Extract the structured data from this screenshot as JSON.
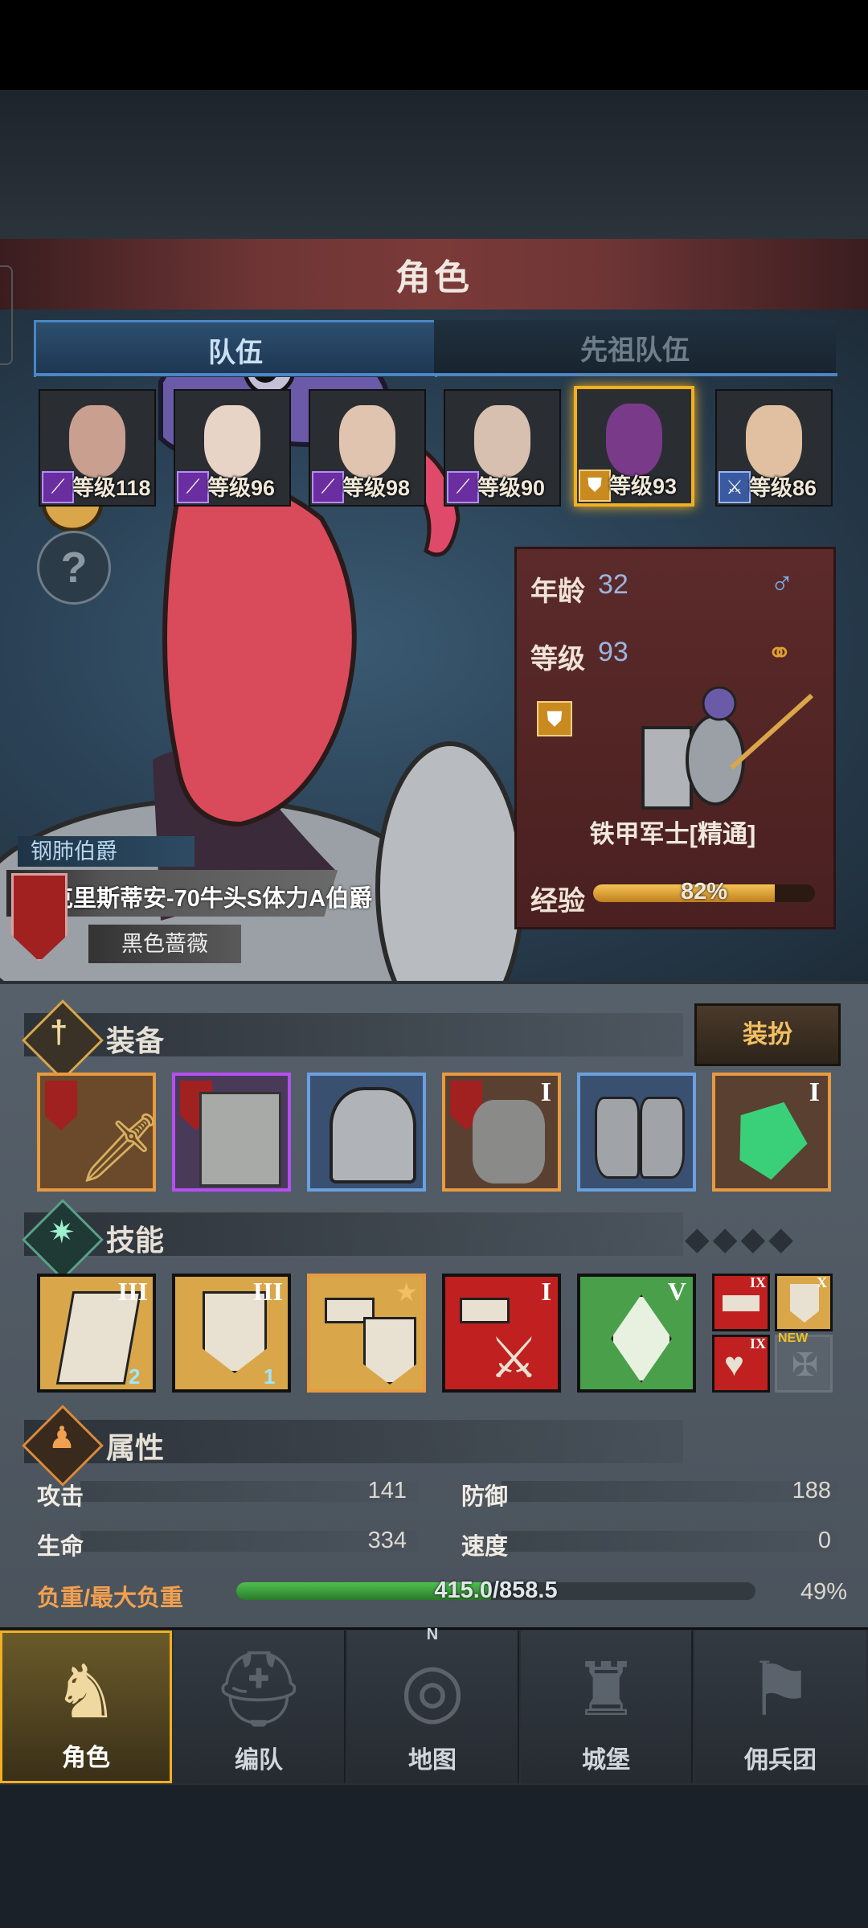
{
  "header": {
    "title": "角色"
  },
  "tabs": {
    "team": "队伍",
    "ancestor": "先祖队伍"
  },
  "party": [
    {
      "level": "等级118",
      "face": "#c9a090",
      "badge": "staff-icon"
    },
    {
      "level": "等级96",
      "face": "#e8d4c6",
      "badge": "staff-icon"
    },
    {
      "level": "等级98",
      "face": "#e0c4b0",
      "badge": "staff-icon"
    },
    {
      "level": "等级90",
      "face": "#d8c0b0",
      "badge": "staff-icon"
    },
    {
      "level": "等级93",
      "face": "#7a3a8a",
      "badge": "shield-icon"
    },
    {
      "level": "等级86",
      "face": "#e0c0a0",
      "badge": "sword-icon"
    }
  ],
  "hero": {
    "title_tag": "钢肺伯爵",
    "name": "克里斯蒂安-70牛头S体力A伯爵",
    "faction": "黑色蔷薇",
    "age_label": "年龄",
    "age": "32",
    "level_label": "等级",
    "level": "93",
    "class": "铁甲军士[精通]",
    "exp_label": "经验",
    "exp": "82%",
    "exp_fraction": 0.82
  },
  "equipment": {
    "title": "装备",
    "dress_button": "装扮"
  },
  "skills": {
    "title": "技能"
  },
  "attributes": {
    "title": "属性",
    "attack_label": "攻击",
    "attack": "141",
    "defense_label": "防御",
    "defense": "188",
    "hp_label": "生命",
    "hp": "334",
    "speed_label": "速度",
    "speed": "0",
    "load_label": "负重/最大负重",
    "load": "415.0/858.5",
    "load_pct": "49%",
    "load_fraction": 0.49
  },
  "nav": {
    "character": "角色",
    "formation": "编队",
    "map": "地图",
    "castle": "城堡",
    "mercenary": "佣兵团",
    "compass_n": "N"
  },
  "skill_tiers": [
    "III",
    "III",
    "",
    "I",
    "V"
  ],
  "skill_counts": [
    "2",
    "1"
  ],
  "mini_tiers": [
    "IX",
    "X",
    "IX"
  ],
  "new_tag": "NEW",
  "equip_tiers": [
    "I",
    "I"
  ],
  "colors": {
    "accent": "#f2b020",
    "header": "#6e3535",
    "exp": "#e0a030",
    "load": "#3cae3c"
  }
}
